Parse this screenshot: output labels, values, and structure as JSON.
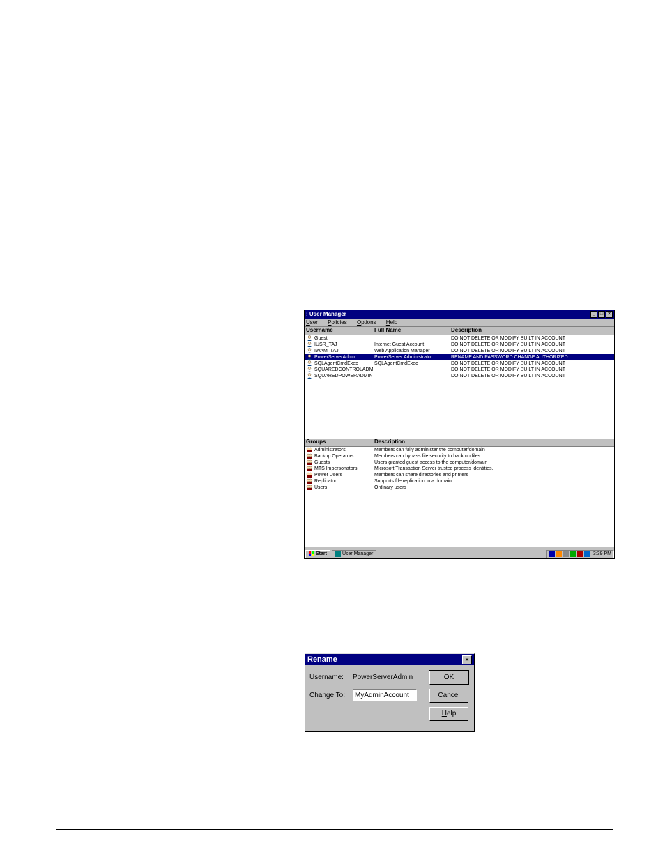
{
  "user_manager": {
    "title": ": User Manager",
    "menu": {
      "user": "User",
      "policies": "Policies",
      "options": "Options",
      "help": "Help"
    },
    "headers": {
      "username": "Username",
      "fullname": "Full Name",
      "description": "Description"
    },
    "users": [
      {
        "username": "Guest",
        "fullname": "",
        "description": "DO NOT DELETE OR MODIFY BUILT IN ACCOUNT",
        "selected": false
      },
      {
        "username": "IUSR_TAJ",
        "fullname": "Internet Guest Account",
        "description": "DO NOT DELETE OR MODIFY BUILT IN ACCOUNT",
        "selected": false
      },
      {
        "username": "IWAM_TAJ",
        "fullname": "Web Application Manager",
        "description": "DO NOT DELETE OR MODIFY BUILT IN ACCOUNT",
        "selected": false
      },
      {
        "username": "PowerServerAdmin",
        "fullname": "PowerServer Administrator",
        "description": "RENAME AND PASSWORD CHANGE AUTHORIZED",
        "selected": true
      },
      {
        "username": "SQLAgentCmdExec",
        "fullname": "SQLAgentCmdExec",
        "description": "DO NOT DELETE OR MODIFY BUILT IN ACCOUNT",
        "selected": false
      },
      {
        "username": "SQUAREDCONTROLADM",
        "fullname": "",
        "description": "DO NOT DELETE OR MODIFY BUILT IN ACCOUNT",
        "selected": false
      },
      {
        "username": "SQUAREDPOWERADMIN",
        "fullname": "",
        "description": "DO NOT DELETE OR MODIFY BUILT IN ACCOUNT",
        "selected": false
      }
    ],
    "groups_headers": {
      "groups": "Groups",
      "description": "Description"
    },
    "groups": [
      {
        "name": "Administrators",
        "description": "Members can fully administer the computer/domain"
      },
      {
        "name": "Backup Operators",
        "description": "Members can bypass file security to back up files"
      },
      {
        "name": "Guests",
        "description": "Users granted guest access to the computer/domain"
      },
      {
        "name": "MTS Impersonators",
        "description": "Microsoft Transaction Server trusted process identities."
      },
      {
        "name": "Power Users",
        "description": "Members can share directories and printers"
      },
      {
        "name": "Replicator",
        "description": "Supports file replication in a domain"
      },
      {
        "name": "Users",
        "description": "Ordinary users"
      }
    ],
    "taskbar": {
      "start": "Start",
      "task": "User Manager",
      "clock": "3:39 PM"
    }
  },
  "rename_dialog": {
    "title": "Rename",
    "labels": {
      "username": "Username:",
      "changeto": "Change To:"
    },
    "username_value": "PowerServerAdmin",
    "changeto_value": "MyAdminAccount",
    "buttons": {
      "ok": "OK",
      "cancel": "Cancel",
      "help": "Help"
    }
  }
}
